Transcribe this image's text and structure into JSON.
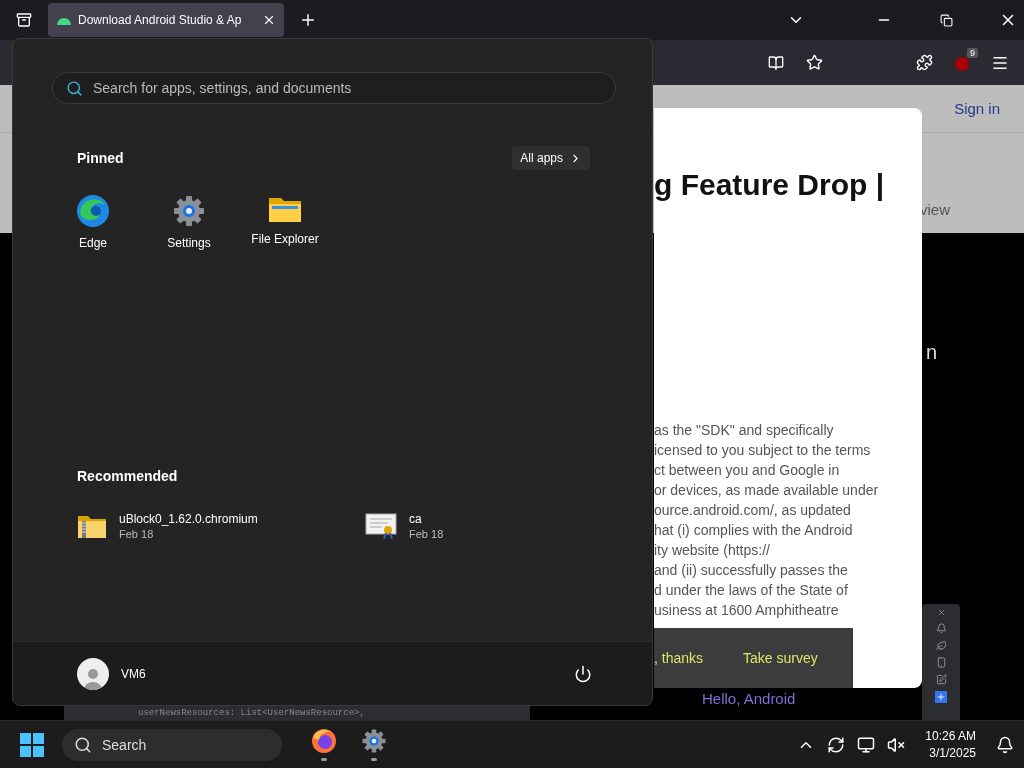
{
  "browser": {
    "tabs": [
      {
        "title": "Download Android Studio & Ap",
        "selected": true
      }
    ],
    "extension_badge": "9"
  },
  "page": {
    "nav": {
      "sign_in": "Sign in"
    },
    "subnav_text": "view",
    "hero_text": "n",
    "dialog": {
      "heading": "g Feature Drop |",
      "lines": [
        "as the \"SDK\" and specifically",
        "icensed to you subject to the terms",
        "ct between you and Google in",
        "or devices, as made available under",
        "ource.android.com/, as updated",
        "hat (i) complies with the Android",
        "ity website (https://",
        "and (ii) successfully passes the",
        "d under the laws of the State of",
        "usiness at 1600 Amphitheatre"
      ]
    },
    "survey": {
      "dismiss": ", thanks",
      "accept": "Take survey"
    },
    "ide": {
      "code": "userNewsResources: List<UserNewsResource>,",
      "greeting": "Hello, Android"
    }
  },
  "start_menu": {
    "search": {
      "placeholder": "Search for apps, settings, and documents"
    },
    "pinned": {
      "title": "Pinned",
      "all_apps": "All apps",
      "apps": [
        {
          "name": "Edge",
          "kind": "edge"
        },
        {
          "name": "Settings",
          "kind": "settings"
        },
        {
          "name": "File Explorer",
          "kind": "folder"
        }
      ]
    },
    "recommended": {
      "title": "Recommended",
      "items": [
        {
          "name": "uBlock0_1.62.0.chromium",
          "date": "Feb 18",
          "kind": "zip"
        },
        {
          "name": "ca",
          "date": "Feb 18",
          "kind": "certificate"
        }
      ]
    },
    "user": {
      "name": "VM6"
    }
  },
  "taskbar": {
    "search_placeholder": "Search",
    "apps": [
      {
        "kind": "firefox",
        "running": true
      },
      {
        "kind": "settings",
        "running": true
      }
    ],
    "time": "10:26 AM",
    "date": "3/1/2025"
  }
}
